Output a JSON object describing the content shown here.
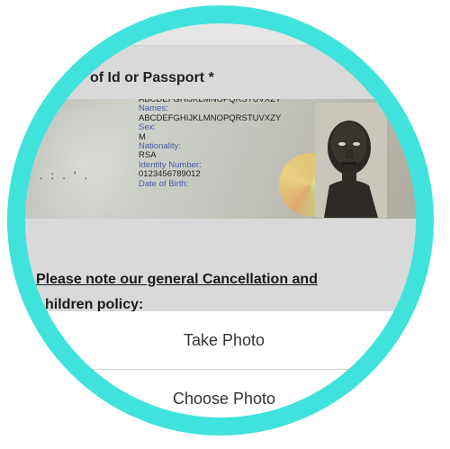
{
  "form": {
    "field_label": "of Id or Passport *",
    "note_line1": "Please note our general Cancellation and",
    "note_line2": "hildren policy:"
  },
  "id_document": {
    "fields": [
      {
        "kind": "val",
        "text": "ABCDEFGHIJKLMNOPQRSTUVXZY"
      },
      {
        "kind": "lbl",
        "text": "Names:"
      },
      {
        "kind": "val",
        "text": "ABCDEFGHIJKLMNOPQRSTUVXZY"
      },
      {
        "kind": "lbl",
        "text": "Sex:"
      },
      {
        "kind": "val",
        "text": "M"
      },
      {
        "kind": "lbl",
        "text": "Nationality:"
      },
      {
        "kind": "val",
        "text": "RSA"
      },
      {
        "kind": "lbl",
        "text": "Identity Number:"
      },
      {
        "kind": "val",
        "text": "0123456789012"
      },
      {
        "kind": "lbl",
        "text": "Date of Birth:"
      }
    ],
    "dots": ". : . ' ."
  },
  "action_sheet": {
    "take_photo": "Take Photo",
    "choose_photo": "Choose Photo"
  },
  "colors": {
    "ring": "#3fe3dc",
    "backdrop": "#d9d9d9"
  }
}
